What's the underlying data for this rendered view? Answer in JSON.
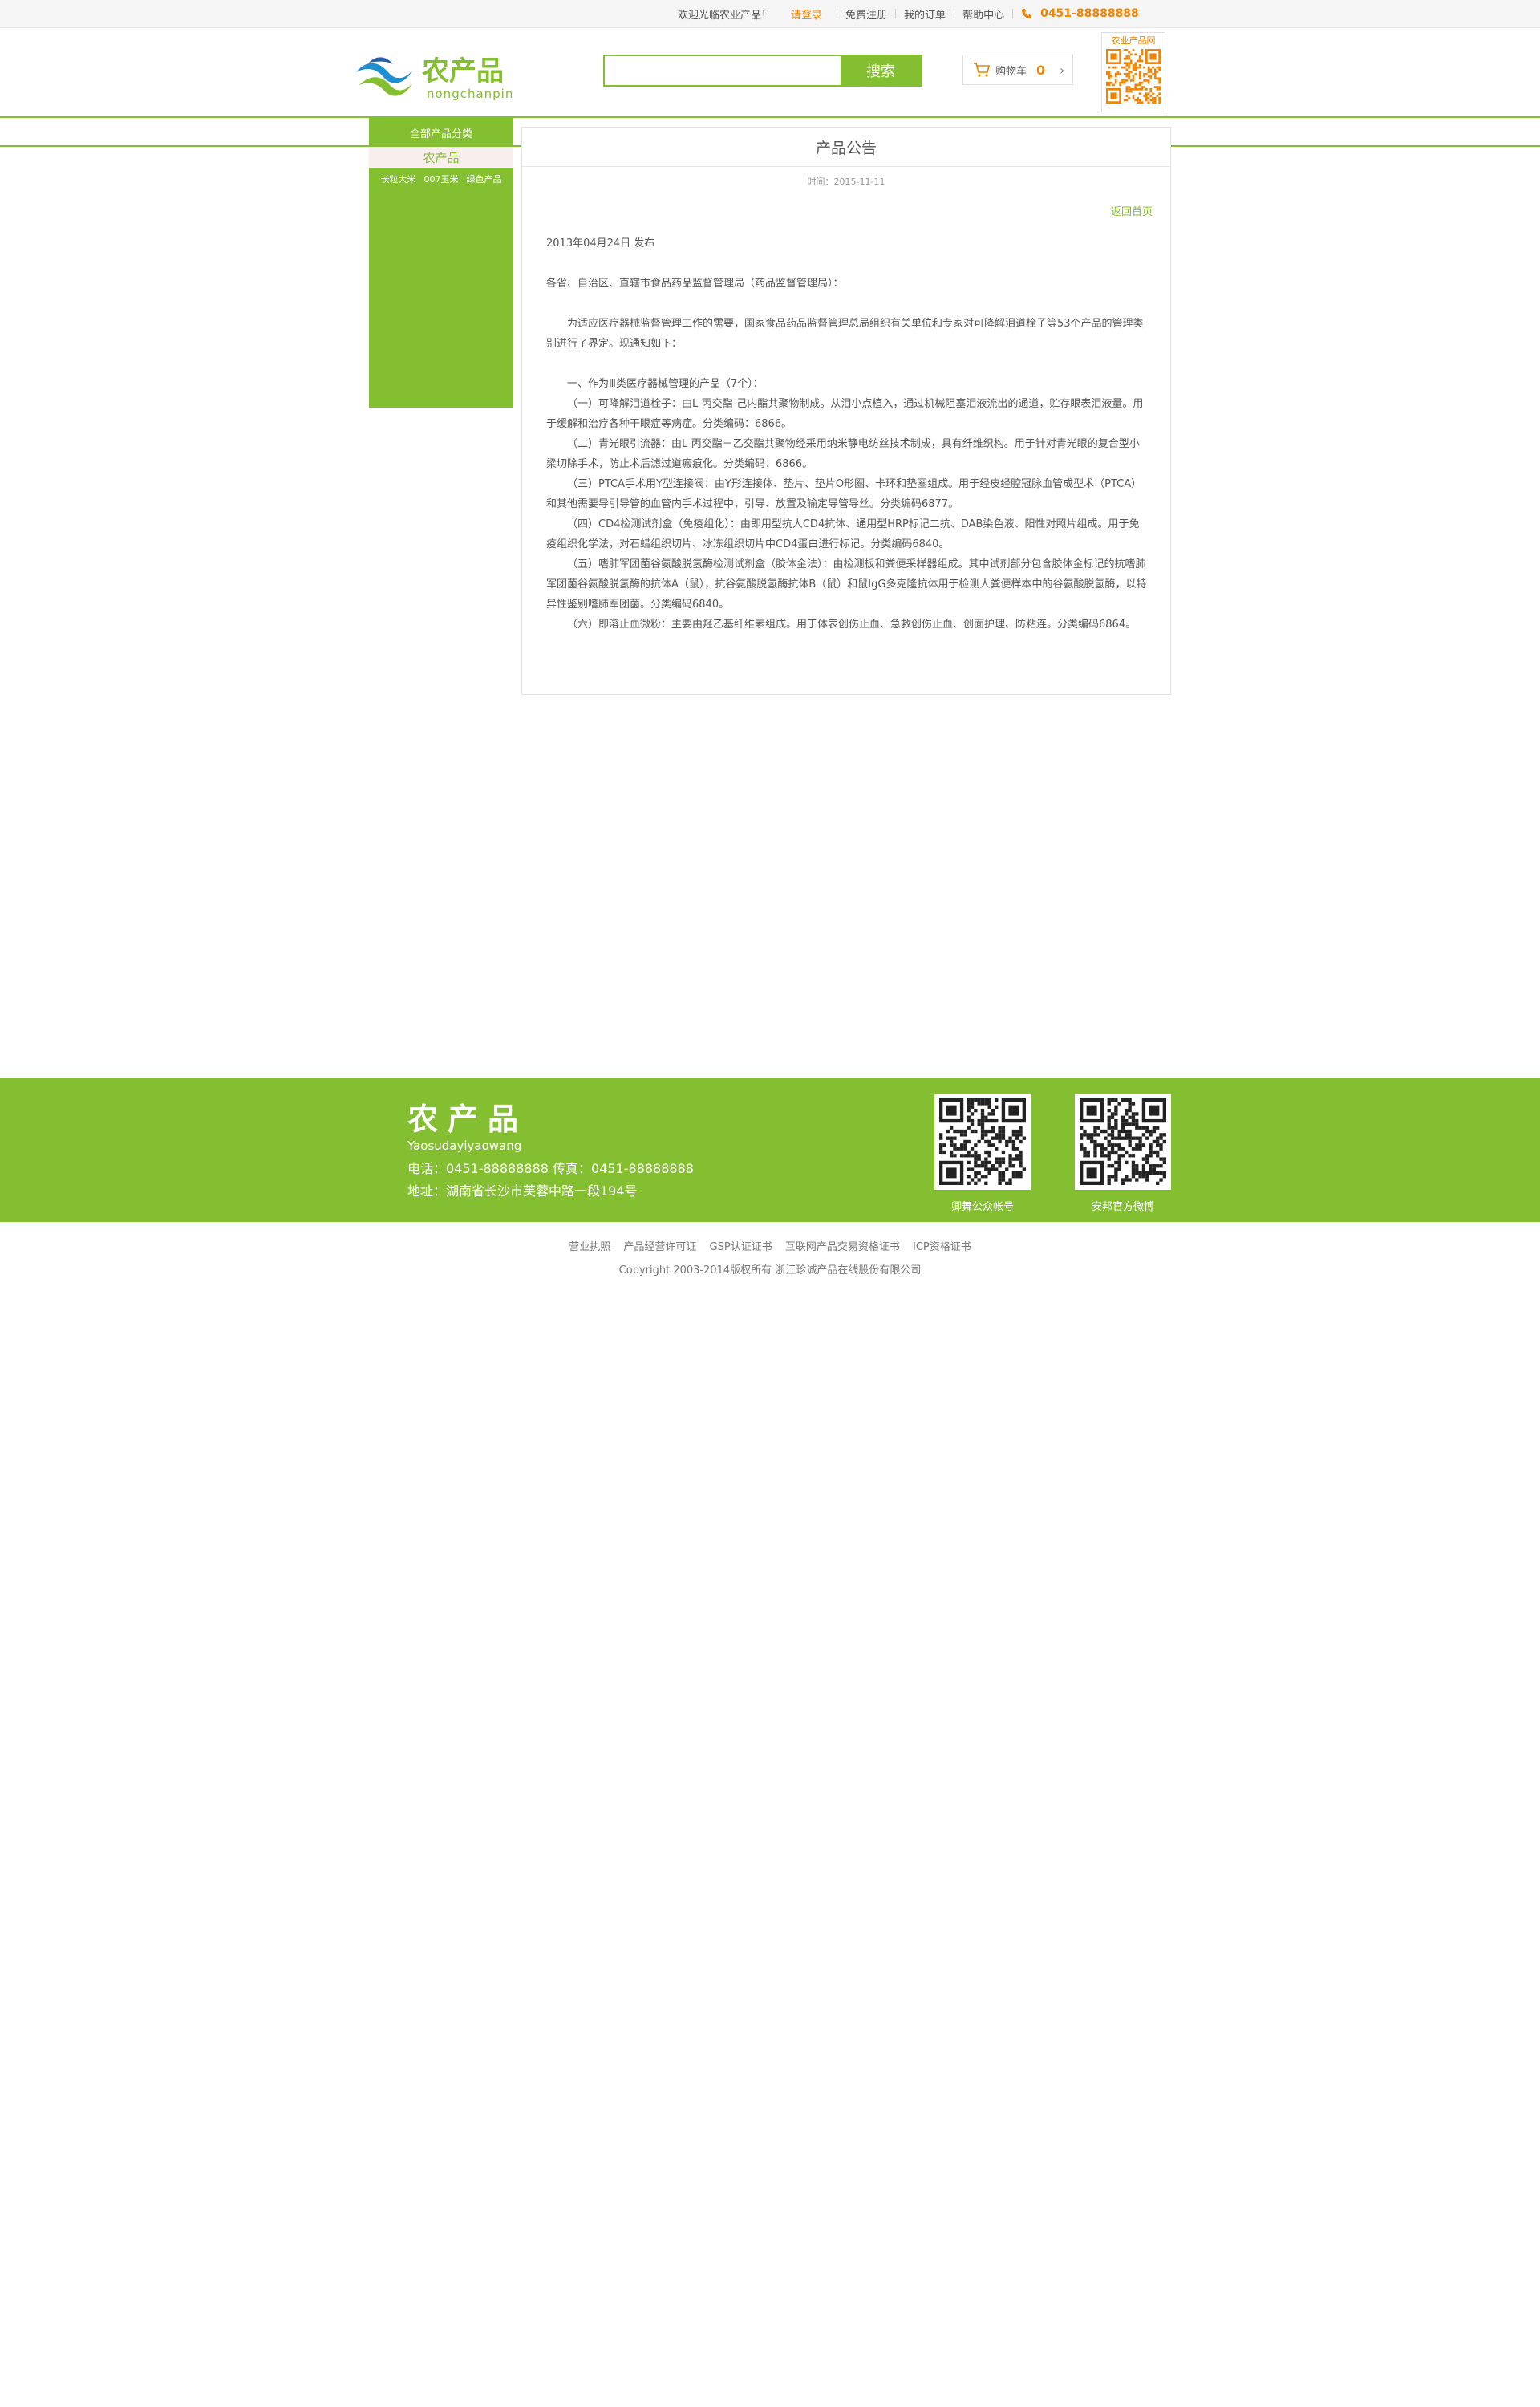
{
  "topbar": {
    "welcome": "欢迎光临农业产品！",
    "login": "请登录",
    "register": "免费注册",
    "orders": "我的订单",
    "help": "帮助中心",
    "phone": "0451-88888888"
  },
  "header": {
    "logo_cn": "农产品",
    "logo_en": "nongchanpin",
    "search_placeholder": "",
    "search_button": "搜索",
    "cart_label": "购物车",
    "cart_count": "0",
    "qr_label": "农业产品网"
  },
  "sidebar": {
    "title": "全部产品分类",
    "category": "农产品",
    "items": [
      "长粒大米",
      "007玉米",
      "绿色产品"
    ]
  },
  "article": {
    "title": "产品公告",
    "time": "时间：2015-11-11",
    "back": "返回首页",
    "date": "2013年04月24日 发布",
    "salutation": "各省、自治区、直辖市食品药品监督管理局（药品监督管理局）：",
    "intro": "为适应医疗器械监督管理工作的需要，国家食品药品监督管理总局组织有关单位和专家对可降解泪道栓子等53个产品的管理类别进行了界定。现通知如下：",
    "section": "一、作为Ⅲ类医疗器械管理的产品（7个）：",
    "items": [
      "（一）可降解泪道栓子：由L-丙交酯-己内酯共聚物制成。从泪小点植入，通过机械阻塞泪液流出的通道，贮存眼表泪液量。用于缓解和治疗各种干眼症等病症。分类编码：6866。",
      "（二）青光眼引流器：由L-丙交酯－乙交酯共聚物经采用纳米静电纺丝技术制成，具有纤维织构。用于针对青光眼的复合型小梁切除手术，防止术后滤过道瘢痕化。分类编码：6866。",
      "（三）PTCA手术用Y型连接阀：由Y形连接体、垫片、垫片O形圈、卡环和垫圈组成。用于经皮经腔冠脉血管成型术（PTCA）和其他需要导引导管的血管内手术过程中，引导、放置及输定导管导丝。分类编码6877。",
      "（四）CD4检测试剂盒（免疫组化）：由即用型抗人CD4抗体、通用型HRP标记二抗、DAB染色液、阳性对照片组成。用于免疫组织化学法，对石蜡组织切片、冰冻组织切片中CD4蛋白进行标记。分类编码6840。",
      "（五）嗜肺军团菌谷氨酸脱氢酶检测试剂盒（胶体金法）：由检测板和粪便采样器组成。其中试剂部分包含胶体金标记的抗嗜肺军团菌谷氨酸脱氢酶的抗体A（鼠），抗谷氨酸脱氢酶抗体B（鼠）和鼠IgG多克隆抗体用于检测人粪便样本中的谷氨酸脱氢酶，以特异性鉴别嗜肺军团菌。分类编码6840。",
      "（六）即溶止血微粉：主要由羟乙基纤维素组成。用于体表创伤止血、急救创伤止血、创面护理、防粘连。分类编码6864。"
    ]
  },
  "footer": {
    "logo": "农产品",
    "sub": "Yaosudayiyaowang",
    "phone": "电话：0451-88888888 传真：0451-88888888",
    "address": "地址：湖南省长沙市芙蓉中路一段194号",
    "qr1_caption": "卿舞公众帐号",
    "qr2_caption": "安邦官方微博",
    "links": [
      "营业执照",
      "产品经营许可证",
      "GSP认证证书",
      "互联网产品交易资格证书",
      "ICP资格证书"
    ],
    "copyright": "Copyright 2003-2014版权所有 浙江珍诚产品在线股份有限公司"
  },
  "colors": {
    "brand_green": "#84bf31",
    "accent_orange": "#f08300"
  }
}
